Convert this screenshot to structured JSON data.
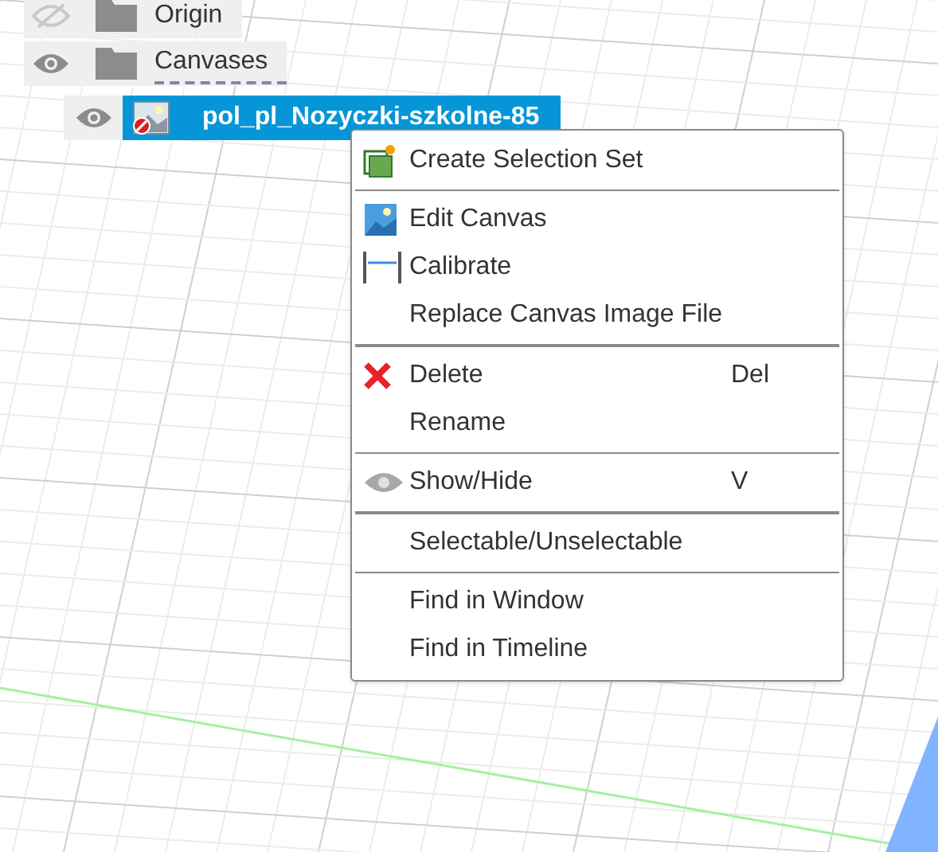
{
  "browser_tree": [
    {
      "label": "Origin",
      "visible": false,
      "selected": false
    },
    {
      "label": "Canvases",
      "visible": true,
      "selected": false,
      "children": [
        {
          "label": "pol_pl_Nozyczki-szkolne-85",
          "visible": true,
          "selected": true
        }
      ]
    }
  ],
  "context_menu": {
    "items": [
      {
        "kind": "item",
        "label": "Create Selection Set"
      },
      {
        "kind": "separator"
      },
      {
        "kind": "item",
        "label": "Edit Canvas"
      },
      {
        "kind": "item",
        "label": "Calibrate"
      },
      {
        "kind": "item",
        "label": "Replace Canvas Image File"
      },
      {
        "kind": "thick_separator"
      },
      {
        "kind": "item",
        "label": "Delete",
        "shortcut": "Del"
      },
      {
        "kind": "item",
        "label": "Rename"
      },
      {
        "kind": "separator"
      },
      {
        "kind": "item",
        "label": "Show/Hide",
        "shortcut": "V"
      },
      {
        "kind": "thick_separator"
      },
      {
        "kind": "item",
        "label": "Selectable/Unselectable"
      },
      {
        "kind": "separator"
      },
      {
        "kind": "item",
        "label": "Find in Window"
      },
      {
        "kind": "item",
        "label": "Find in Timeline"
      }
    ]
  }
}
